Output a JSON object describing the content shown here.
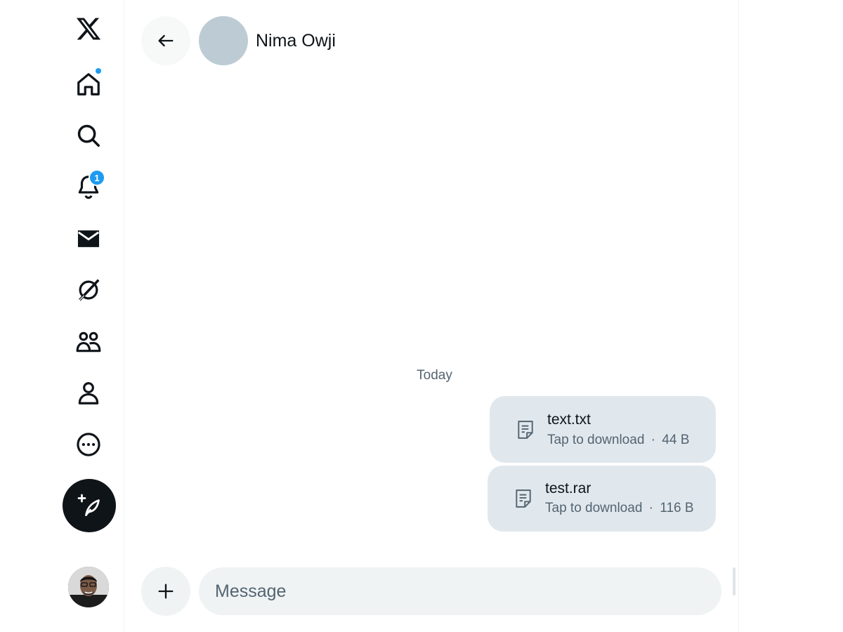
{
  "nav": {
    "items": [
      {
        "name": "x-logo",
        "icon": "x-logo-icon"
      },
      {
        "name": "home",
        "icon": "home-icon",
        "has_dot": true
      },
      {
        "name": "explore",
        "icon": "search-icon"
      },
      {
        "name": "notifications",
        "icon": "bell-icon",
        "badge": "1"
      },
      {
        "name": "messages",
        "icon": "envelope-icon"
      },
      {
        "name": "grok",
        "icon": "grok-icon"
      },
      {
        "name": "communities",
        "icon": "people-icon"
      },
      {
        "name": "profile",
        "icon": "person-icon"
      },
      {
        "name": "more",
        "icon": "more-circle-icon"
      }
    ],
    "compose_icon": "feather-plus-icon",
    "accent_color": "#1d9bf0"
  },
  "conversation": {
    "contact_name": "Nima Owji",
    "date_separator": "Today",
    "messages": [
      {
        "type": "file",
        "file_name": "text.txt",
        "action": "Tap to download",
        "size": "44 B",
        "icon": "file-icon"
      },
      {
        "type": "file",
        "file_name": "test.rar",
        "action": "Tap to download",
        "size": "116 B",
        "icon": "file-icon"
      }
    ],
    "separator_dot": "·"
  },
  "composer": {
    "placeholder": "Message",
    "add_icon": "plus-icon"
  }
}
